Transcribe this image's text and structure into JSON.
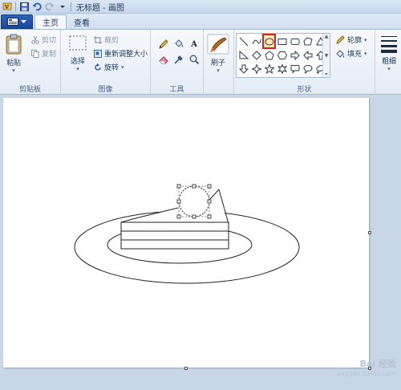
{
  "titlebar": {
    "title": "无标题 - 画图"
  },
  "tabs": {
    "home": "主页",
    "view": "查看"
  },
  "clipboard": {
    "paste": "粘贴",
    "cut": "剪切",
    "copy": "复制",
    "group": "剪贴板"
  },
  "image": {
    "select": "选择",
    "crop": "裁剪",
    "resize": "重新调整大小",
    "rotate": "旋转",
    "group": "图像"
  },
  "tools": {
    "text_tool": "A",
    "group": "工具"
  },
  "brushes": {
    "label": "刷子"
  },
  "shapes": {
    "outline": "轮廓",
    "fill": "填充",
    "group": "形状",
    "items": [
      "line",
      "curve",
      "oval",
      "rectangle",
      "rounded-rectangle",
      "polygon",
      "triangle",
      "right-triangle",
      "diamond",
      "pentagon",
      "hexagon",
      "arrow-right",
      "arrow-left",
      "arrow-up",
      "arrow-down",
      "star-4",
      "star-5",
      "star-6",
      "callout-rounded",
      "callout-oval",
      "callout-cloud"
    ],
    "selected": "oval"
  },
  "size": {
    "label": "粗细"
  },
  "watermark": {
    "main": "Bai 经验",
    "sub": "jingyan.baidu.com"
  },
  "colors": {
    "ribbon_bg": "#eef3fa",
    "workspace_bg": "#c8d6e8",
    "app_button": "#2355a8",
    "selection_highlight": "#e21a1a"
  }
}
